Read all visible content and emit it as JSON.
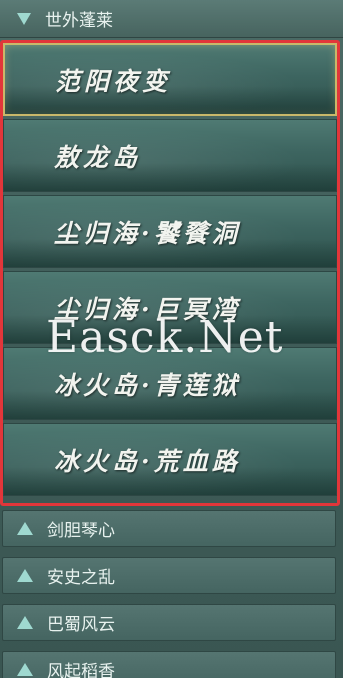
{
  "expanded_group": {
    "label": "世外蓬莱",
    "icon": "triangle-down-icon"
  },
  "sub_items": [
    {
      "label": "范阳夜变",
      "selected": true
    },
    {
      "label": "敖龙岛",
      "selected": false
    },
    {
      "label": "尘归海·饕餮洞",
      "selected": false
    },
    {
      "label": "尘归海·巨冥湾",
      "selected": false
    },
    {
      "label": "冰火岛·青莲狱",
      "selected": false
    },
    {
      "label": "冰火岛·荒血路",
      "selected": false
    }
  ],
  "collapsed_groups": [
    {
      "label": "剑胆琴心",
      "icon": "triangle-up-icon"
    },
    {
      "label": "安史之乱",
      "icon": "triangle-up-icon"
    },
    {
      "label": "巴蜀风云",
      "icon": "triangle-up-icon"
    },
    {
      "label": "风起稻香",
      "icon": "triangle-up-icon"
    }
  ],
  "watermark": "Easck.Net",
  "colors": {
    "highlight_frame": "#e2363a",
    "selected_border": "#c9b86a",
    "triangle_icon": "#9fd9d0"
  }
}
